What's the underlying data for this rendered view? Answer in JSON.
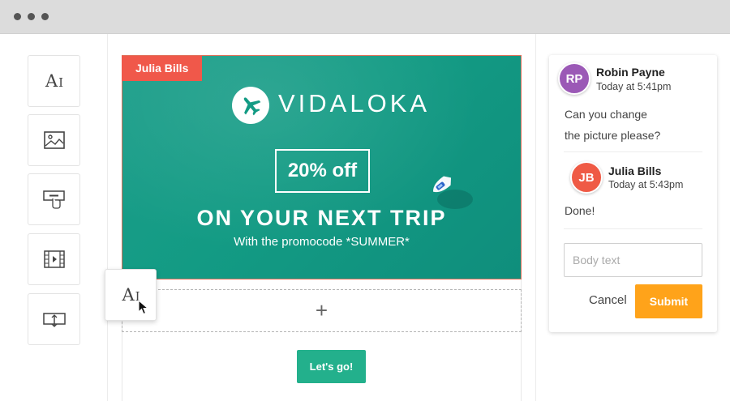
{
  "window": {
    "controls": [
      "dot",
      "dot",
      "dot"
    ]
  },
  "toolbar": {
    "tools": [
      {
        "name": "text-tool",
        "icon": "text-icon"
      },
      {
        "name": "image-tool",
        "icon": "image-icon"
      },
      {
        "name": "button-tool",
        "icon": "button-icon"
      },
      {
        "name": "video-tool",
        "icon": "video-icon"
      },
      {
        "name": "spacer-tool",
        "icon": "spacer-icon"
      }
    ],
    "text_icon_glyph": "A",
    "text_icon_cursor": "I"
  },
  "canvas": {
    "editing_user_tag": "Julia Bills",
    "brand_name": "VIDALOKA",
    "promo_badge": "20% off",
    "headline": "ON YOUR NEXT TRIP",
    "subline": "With the promocode *SUMMER*",
    "add_block_symbol": "+",
    "cta_label": "Let's go!",
    "banner_color": "#139b84",
    "tag_color": "#f0584a",
    "cta_color": "#23b08c"
  },
  "comments": {
    "thread": [
      {
        "initials": "RP",
        "author": "Robin Payne",
        "time": "Today at 5:41pm",
        "message_lines": [
          "Can you change",
          "the picture please?"
        ],
        "avatar_color": "#9b59b6"
      },
      {
        "initials": "JB",
        "author": "Julia Bills",
        "time": "Today at 5:43pm",
        "message_lines": [
          "Done!"
        ],
        "avatar_color": "#ef5a45"
      }
    ],
    "input_placeholder": "Body text",
    "cancel_label": "Cancel",
    "submit_label": "Submit",
    "submit_color": "#ffa31a"
  }
}
